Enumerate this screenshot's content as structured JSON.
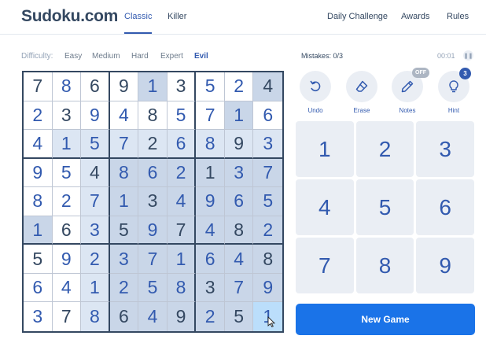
{
  "header": {
    "logo": "Sudoku.com",
    "tabs": [
      {
        "label": "Classic",
        "active": true
      },
      {
        "label": "Killer",
        "active": false
      }
    ],
    "links": [
      {
        "label": "Daily Challenge"
      },
      {
        "label": "Awards"
      },
      {
        "label": "Rules"
      }
    ]
  },
  "difficulty": {
    "label": "Difficulty:",
    "options": [
      "Easy",
      "Medium",
      "Hard",
      "Expert",
      "Evil"
    ],
    "selected": "Evil"
  },
  "status": {
    "mistakes": "Mistakes: 0/3",
    "timer": "00:01"
  },
  "board": {
    "values": [
      [
        7,
        8,
        6,
        9,
        1,
        3,
        5,
        2,
        4
      ],
      [
        2,
        3,
        9,
        4,
        8,
        5,
        7,
        1,
        6
      ],
      [
        4,
        1,
        5,
        7,
        2,
        6,
        8,
        9,
        3
      ],
      [
        9,
        5,
        4,
        8,
        6,
        2,
        1,
        3,
        7
      ],
      [
        8,
        2,
        7,
        1,
        3,
        4,
        9,
        6,
        5
      ],
      [
        1,
        6,
        3,
        5,
        9,
        7,
        4,
        8,
        2
      ],
      [
        5,
        9,
        2,
        3,
        7,
        1,
        6,
        4,
        8
      ],
      [
        6,
        4,
        1,
        2,
        5,
        8,
        3,
        7,
        9
      ],
      [
        3,
        7,
        8,
        6,
        4,
        9,
        2,
        5,
        1
      ]
    ],
    "types": [
      "GUGGUGUUG",
      "UGUUGUUUU",
      "UUUUGUUGU",
      "UUGUUUGUU",
      "UUUUGUUUU",
      "UGUGUGUGU",
      "GUUUUUUUG",
      "UUUUUUGUU",
      "UGUGUGUGU"
    ],
    "shades": [
      "000020002",
      "000000020",
      "011111111",
      "001222222",
      "001222222",
      "201222222",
      "001222222",
      "001222222",
      "001222224"
    ],
    "colors": {
      "given": "#344861",
      "user": "#325aaf",
      "selected": "#bbdefb"
    }
  },
  "tools": {
    "undo": "Undo",
    "erase": "Erase",
    "notes": "Notes",
    "notes_state": "OFF",
    "hint": "Hint",
    "hints_left": "3"
  },
  "numpad": [
    "1",
    "2",
    "3",
    "4",
    "5",
    "6",
    "7",
    "8",
    "9"
  ],
  "new_game": "New Game",
  "accent_color": "#325aaf"
}
